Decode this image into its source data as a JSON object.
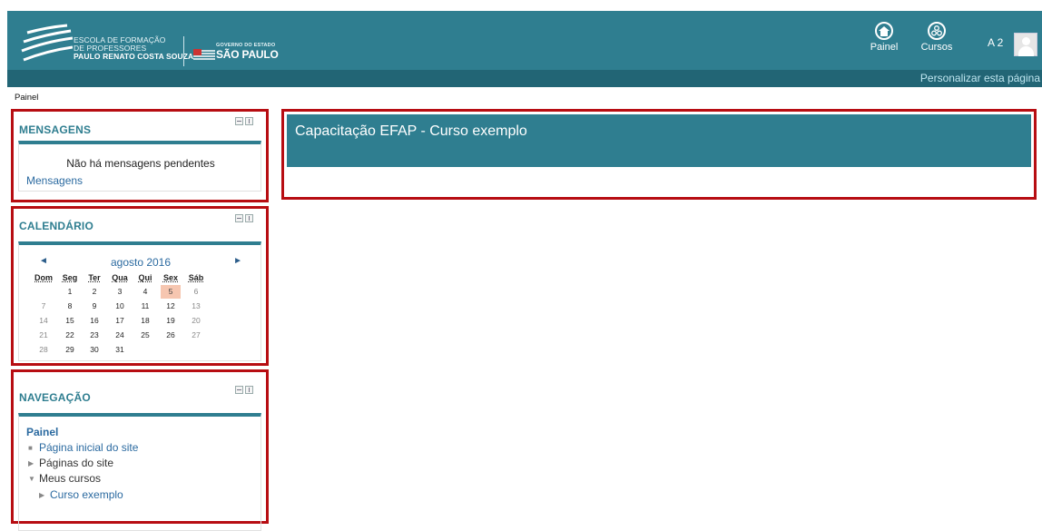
{
  "header": {
    "logo_line1": "ESCOLA DE FORMAÇÃO",
    "logo_line2": "DE PROFESSORES",
    "logo_line3": "PAULO RENATO COSTA SOUZA",
    "gov_small": "GOVERNO DO ESTADO",
    "gov_name": "SÃO PAULO",
    "nav_painel": "Painel",
    "nav_cursos": "Cursos",
    "user_initials": "A 2",
    "customize_link": "Personalizar esta página",
    "colors": {
      "brand": "#2f7e90",
      "brand_dark": "#226575",
      "highlight_border": "#b70d12"
    }
  },
  "breadcrumb": "Painel",
  "blocks": {
    "messages": {
      "title": "MENSAGENS",
      "empty_text": "Não há mensagens pendentes",
      "link": "Mensagens"
    },
    "calendar": {
      "title": "CALENDÁRIO",
      "month": "agosto 2016",
      "prev_icon": "◄",
      "next_icon": "►",
      "weekdays": [
        "Dom",
        "Seg",
        "Ter",
        "Qua",
        "Qui",
        "Sex",
        "Sáb"
      ],
      "weeks": [
        [
          "",
          "1",
          "2",
          "3",
          "4",
          "5",
          "6"
        ],
        [
          "7",
          "8",
          "9",
          "10",
          "11",
          "12",
          "13"
        ],
        [
          "14",
          "15",
          "16",
          "17",
          "18",
          "19",
          "20"
        ],
        [
          "21",
          "22",
          "23",
          "24",
          "25",
          "26",
          "27"
        ],
        [
          "28",
          "29",
          "30",
          "31",
          "",
          "",
          ""
        ]
      ],
      "today": "5"
    },
    "navigation": {
      "title": "NAVEGAÇÃO",
      "root": "Painel",
      "items": [
        {
          "label": "Página inicial do site",
          "icon": "square-bullet-icon"
        },
        {
          "label": "Páginas do site",
          "icon": "triangle-right-icon"
        },
        {
          "label": "Meus cursos",
          "icon": "triangle-down-icon"
        },
        {
          "label": "Curso exemplo",
          "icon": "triangle-right-icon"
        }
      ]
    }
  },
  "course": {
    "title": "Capacitação EFAP - Curso exemplo"
  }
}
